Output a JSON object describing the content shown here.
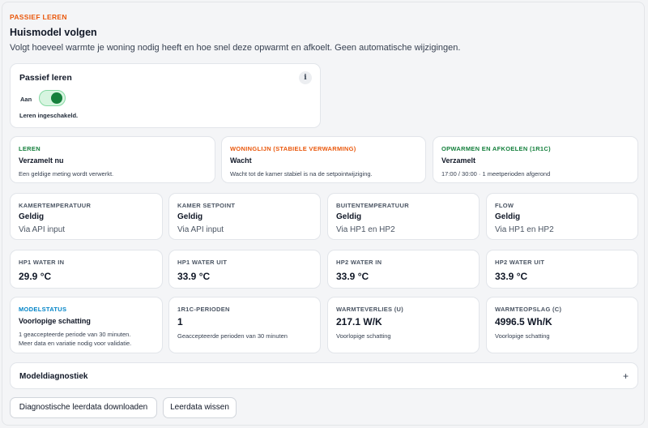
{
  "section": {
    "eyebrow": "PASSIEF LEREN",
    "title": "Huismodel volgen",
    "description": "Volgt hoeveel warmte je woning nodig heeft en hoe snel deze opwarmt en afkoelt. Geen automatische wijzigingen."
  },
  "toggle_card": {
    "title": "Passief leren",
    "info": "i",
    "toggle_label": "Aan",
    "toggle_on": true,
    "status": "Leren ingeschakeld."
  },
  "status_cards": [
    {
      "eyebrow": "LEREN",
      "value": "Verzamelt nu",
      "sub": "Een geldige meting wordt verwerkt.",
      "color": "#15803d"
    },
    {
      "eyebrow": "WONINGLIJN (STABIELE VERWARMING)",
      "value": "Wacht",
      "sub": "Wacht tot de kamer stabiel is na de setpointwijziging.",
      "color": "#ea580c"
    },
    {
      "eyebrow": "OPWARMEN EN AFKOELEN (1R1C)",
      "value": "Verzamelt",
      "sub": "17:00 / 30:00 · 1 meetperioden afgerond",
      "color": "#15803d"
    }
  ],
  "sensor_cards": [
    {
      "eyebrow": "KAMERTEMPERATUUR",
      "value": "Geldig",
      "sub": "Via API input"
    },
    {
      "eyebrow": "KAMER SETPOINT",
      "value": "Geldig",
      "sub": "Via API input"
    },
    {
      "eyebrow": "BUITENTEMPERATUUR",
      "value": "Geldig",
      "sub": "Via HP1 en HP2"
    },
    {
      "eyebrow": "FLOW",
      "value": "Geldig",
      "sub": "Via HP1 en HP2"
    }
  ],
  "temp_cards": [
    {
      "eyebrow": "HP1 WATER IN",
      "value": "29.9 °C"
    },
    {
      "eyebrow": "HP1 WATER UIT",
      "value": "33.9 °C"
    },
    {
      "eyebrow": "HP2 WATER IN",
      "value": "33.9 °C"
    },
    {
      "eyebrow": "HP2 WATER UIT",
      "value": "33.9 °C"
    }
  ],
  "model_cards": [
    {
      "eyebrow": "MODELSTATUS",
      "value": "Voorlopige schatting",
      "sub_lines": [
        "1 geaccepteerde periode van 30 minuten.",
        "Meer data en variatie nodig voor validatie."
      ],
      "color": "#0284c7"
    },
    {
      "eyebrow": "1R1C-PERIODEN",
      "value": "1",
      "sub_lines": [
        "Geaccepteerde perioden van 30 minuten"
      ]
    },
    {
      "eyebrow": "WARMTEVERLIES (U)",
      "value": "217.1 W/K",
      "sub_lines": [
        "Voorlopige schatting"
      ]
    },
    {
      "eyebrow": "WARMTEOPSLAG (C)",
      "value": "4996.5 Wh/K",
      "sub_lines": [
        "Voorlopige schatting"
      ]
    }
  ],
  "diagnostics": {
    "title": "Modeldiagnostiek",
    "expand_icon": "+"
  },
  "buttons": {
    "download": "Diagnostische leerdata downloaden",
    "clear": "Leerdata wissen"
  }
}
